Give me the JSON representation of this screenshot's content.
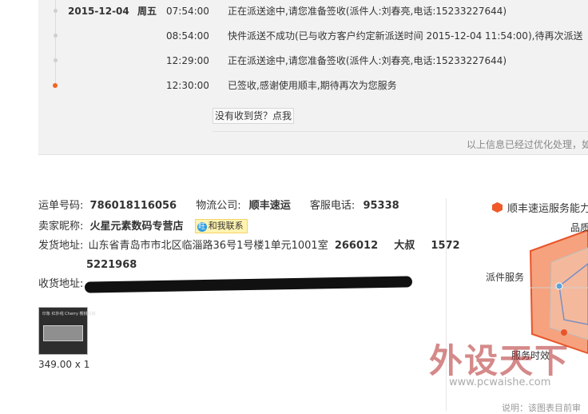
{
  "tracking": {
    "rows": [
      {
        "date": "2015-12-04",
        "weekday": "周五",
        "time": "07:54:00",
        "text": "正在派送途中,请您准备签收(派件人:刘春亮,电话:15233227644)"
      },
      {
        "date": "",
        "weekday": "",
        "time": "08:54:00",
        "text": "快件派送不成功(已与收方客户约定新派送时间 2015-12-04 11:54:00),待再次派送"
      },
      {
        "date": "",
        "weekday": "",
        "time": "12:29:00",
        "text": "正在派送途中,请您准备签收(派件人:刘春亮,电话:15233227644)"
      },
      {
        "date": "",
        "weekday": "",
        "time": "12:30:00",
        "text": "已签收,感谢使用顺丰,期待再次为您服务"
      }
    ],
    "not_received_label": "没有收到货？点我",
    "info_note": "以上信息已经过优化处理，如"
  },
  "order": {
    "tracking_no_label": "运单号码:",
    "tracking_no": "786018116056",
    "company_label": "物流公司:",
    "company": "顺丰速运",
    "service_phone_label": "客服电话:",
    "service_phone": "95338",
    "seller_label": "卖家昵称:",
    "seller": "火星元素数码专营店",
    "contact_label": "和我联系",
    "ship_label": "发货地址:",
    "ship_address": "山东省青岛市市北区临淄路36号1号楼1单元1001室",
    "ship_zip": "266012",
    "ship_name": "大叔",
    "ship_phone_part1": "1572",
    "ship_phone_part2": "5221968",
    "receive_label": "收货地址:",
    "product_caption": "印象 红外线 Cherry 樱桃机械",
    "price": "349.00 x 1"
  },
  "service": {
    "legend": "顺丰速运服务能力",
    "axis_top": "品质",
    "axis_left": "派件服务",
    "axis_bottom": "服务时效",
    "accent": "#f05a28"
  },
  "watermark": {
    "big": "外设天下",
    "url": "www.pcwaishe.com",
    "footnote": "说明：该图表目前审"
  }
}
